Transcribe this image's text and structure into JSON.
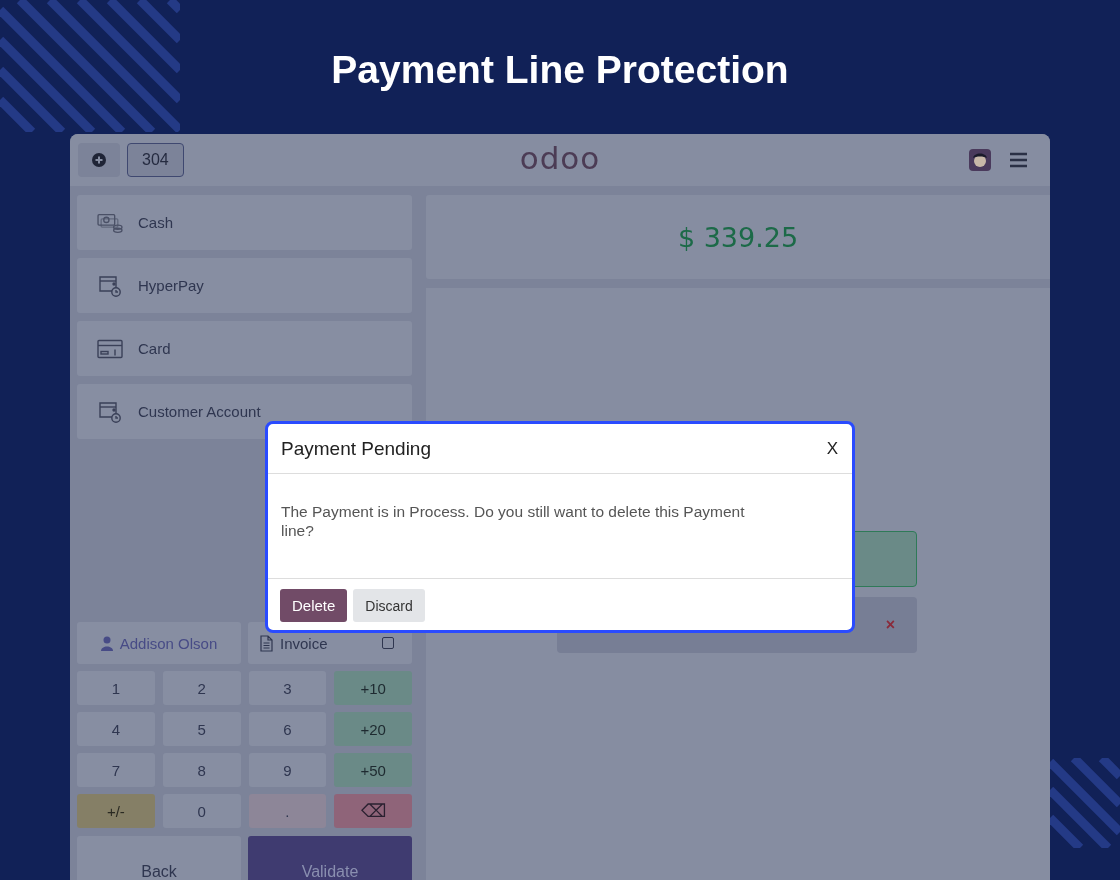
{
  "headline": "Payment Line Protection",
  "header": {
    "order_number": "304",
    "logo": "odoo"
  },
  "payment_methods": [
    {
      "kind": "cash",
      "label": "Cash"
    },
    {
      "kind": "wallet",
      "label": "HyperPay"
    },
    {
      "kind": "card",
      "label": "Card"
    },
    {
      "kind": "wallet",
      "label": "Customer Account"
    }
  ],
  "total": "$ 339.25",
  "payment_lines": [
    {
      "kind": "pending"
    },
    {
      "kind": "removable",
      "remove": "×"
    }
  ],
  "customer": {
    "name": "Addison Olson"
  },
  "invoice": {
    "label": "Invoice",
    "checked": false
  },
  "numpad": [
    {
      "kind": "digit",
      "label": "1"
    },
    {
      "kind": "digit",
      "label": "2"
    },
    {
      "kind": "digit",
      "label": "3"
    },
    {
      "kind": "add",
      "label": "+10"
    },
    {
      "kind": "digit",
      "label": "4"
    },
    {
      "kind": "digit",
      "label": "5"
    },
    {
      "kind": "digit",
      "label": "6"
    },
    {
      "kind": "add",
      "label": "+20"
    },
    {
      "kind": "digit",
      "label": "7"
    },
    {
      "kind": "digit",
      "label": "8"
    },
    {
      "kind": "digit",
      "label": "9"
    },
    {
      "kind": "add",
      "label": "+50"
    },
    {
      "kind": "sign",
      "label": "+/-"
    },
    {
      "kind": "digit",
      "label": "0"
    },
    {
      "kind": "dot",
      "label": "."
    },
    {
      "kind": "backspace",
      "label": "⌫"
    }
  ],
  "actions": [
    {
      "kind": "back",
      "label": "Back"
    },
    {
      "kind": "validate",
      "label": "Validate"
    }
  ],
  "dialog": {
    "title": "Payment Pending",
    "close": "X",
    "message": "The Payment is in Process. Do you still want to delete this Payment line?",
    "buttons": [
      {
        "kind": "primary",
        "label": "Delete"
      },
      {
        "kind": "secondary",
        "label": "Discard"
      }
    ]
  }
}
